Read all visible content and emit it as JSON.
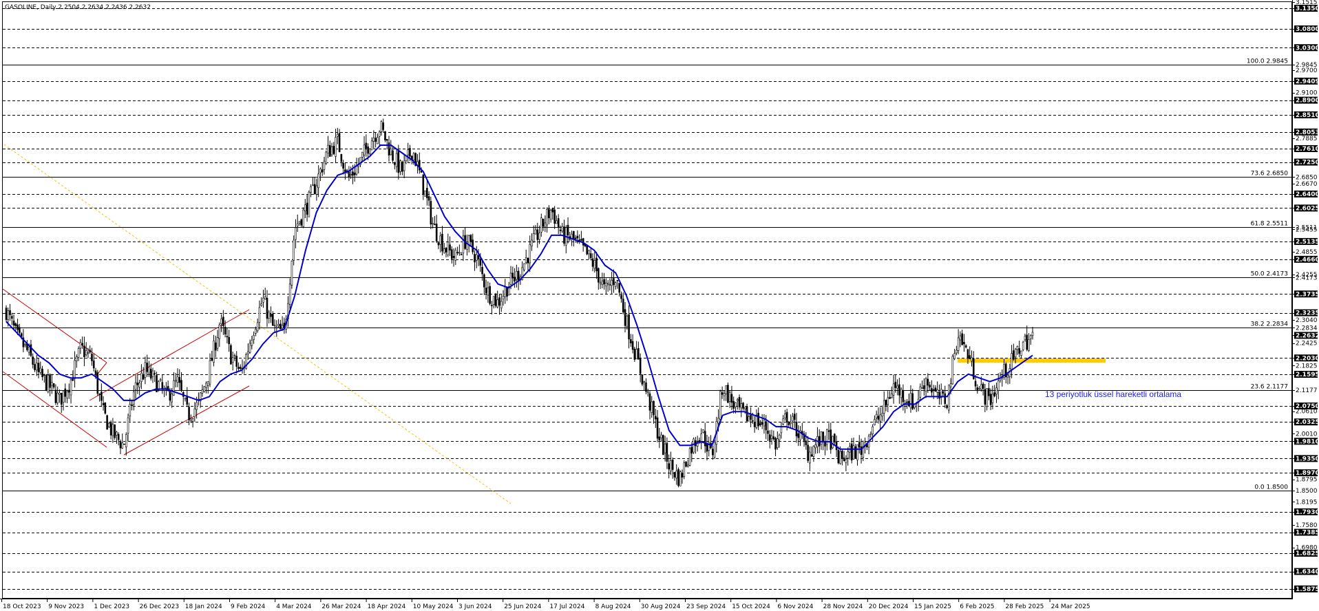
{
  "chart_data": {
    "type": "candlestick",
    "header": "GASOLINE, Daily  2.2504 2.2634 2.2436 2.2632",
    "ylim": [
      1.5635,
      3.1515
    ],
    "price_axis_ticks": [
      "3.1515",
      "3.1350",
      "3.0800",
      "3.0300",
      "2.9845",
      "2.9700",
      "2.9409",
      "2.9100",
      "2.8900",
      "2.8510",
      "2.8053",
      "2.7885",
      "2.7610",
      "2.7250",
      "2.6850",
      "2.6670",
      "2.6400",
      "2.6025",
      "2.5511",
      "2.5455",
      "2.5135",
      "2.4855",
      "2.4660",
      "2.4255",
      "2.4173",
      "2.3735",
      "2.3040",
      "2.2834",
      "2.2632",
      "2.2425",
      "2.2030",
      "2.1825",
      "2.1595",
      "2.1177",
      "2.0750",
      "2.0610",
      "2.0325",
      "2.0010",
      "1.9810",
      "1.9350",
      "1.8970",
      "1.8795",
      "1.8500",
      "1.8195",
      "1.7930",
      "1.7580",
      "1.7385",
      "1.6980",
      "1.6825",
      "1.6340",
      "1.5875"
    ],
    "highlighted_price_labels": [
      "3.1350",
      "3.0800",
      "3.0300",
      "2.9409",
      "2.8900",
      "2.8510",
      "2.8053",
      "2.7610",
      "2.7250",
      "2.6400",
      "2.6025",
      "2.5135",
      "2.4660",
      "2.3735",
      "2.3235",
      "2.2632",
      "2.2030",
      "2.1595",
      "2.0750",
      "2.0325",
      "1.9810",
      "1.9350",
      "1.8970",
      "1.7930",
      "1.7385",
      "1.6825",
      "1.6340",
      "1.5875"
    ],
    "date_labels": [
      "18 Oct 2023",
      "9 Nov 2023",
      "1 Dec 2023",
      "26 Dec 2023",
      "18 Jan 2024",
      "9 Feb 2024",
      "4 Mar 2024",
      "26 Mar 2024",
      "18 Apr 2024",
      "10 May 2024",
      "3 Jun 2024",
      "25 Jun 2024",
      "17 Jul 2024",
      "8 Aug 2024",
      "30 Aug 2024",
      "23 Sep 2024",
      "15 Oct 2024",
      "6 Nov 2024",
      "28 Nov 2024",
      "20 Dec 2024",
      "15 Jan 2025",
      "6 Feb 2025",
      "28 Feb 2025",
      "24 Mar 2025"
    ],
    "fibonacci_levels": [
      {
        "label": "100.0 2.9845",
        "price": 2.9845
      },
      {
        "label": "73.6 2.6850",
        "price": 2.685
      },
      {
        "label": "61.8 2.5511",
        "price": 2.5511
      },
      {
        "label": "50.0 2.4173",
        "price": 2.4173
      },
      {
        "label": "38.2 2.2834",
        "price": 2.2834
      },
      {
        "label": "23.6 2.1177",
        "price": 2.1177
      },
      {
        "label": "0.0 1.8500",
        "price": 1.85
      }
    ],
    "dashed_levels": [
      3.135,
      3.08,
      3.03,
      2.9409,
      2.89,
      2.851,
      2.8053,
      2.761,
      2.725,
      2.64,
      2.6025,
      2.5135,
      2.466,
      2.3735,
      2.3235,
      2.203,
      2.1595,
      2.075,
      2.0325,
      1.981,
      1.935,
      1.897,
      1.793,
      1.7385,
      1.6825,
      1.634,
      1.5875
    ],
    "price_path": [
      2.33,
      2.26,
      2.22,
      2.16,
      2.13,
      2.09,
      2.14,
      2.23,
      2.2,
      2.06,
      2.0,
      1.97,
      2.12,
      2.17,
      2.14,
      2.1,
      2.14,
      2.05,
      2.08,
      2.17,
      2.3,
      2.21,
      2.16,
      2.27,
      2.36,
      2.28,
      2.27,
      2.55,
      2.6,
      2.67,
      2.75,
      2.78,
      2.68,
      2.72,
      2.78,
      2.82,
      2.75,
      2.7,
      2.76,
      2.66,
      2.55,
      2.5,
      2.47,
      2.52,
      2.47,
      2.38,
      2.35,
      2.4,
      2.43,
      2.49,
      2.55,
      2.6,
      2.53,
      2.52,
      2.49,
      2.45,
      2.38,
      2.42,
      2.3,
      2.2,
      2.1,
      2.0,
      1.92,
      1.88,
      1.96,
      2.01,
      1.94,
      2.13,
      2.08,
      2.05,
      2.04,
      2.02,
      1.97,
      2.05,
      2.01,
      1.95,
      1.98,
      1.99,
      1.93,
      1.95,
      1.96,
      2.02,
      2.06,
      2.13,
      2.1,
      2.08,
      2.15,
      2.1,
      2.09,
      2.27,
      2.21,
      2.12,
      2.09,
      2.15,
      2.19,
      2.24,
      2.26
    ],
    "ema_label": "13 periyotluk üssel hareketli ortalama",
    "ema_path": [
      2.3,
      2.27,
      2.24,
      2.21,
      2.19,
      2.16,
      2.15,
      2.15,
      2.16,
      2.14,
      2.12,
      2.09,
      2.09,
      2.11,
      2.12,
      2.12,
      2.11,
      2.1,
      2.09,
      2.1,
      2.14,
      2.16,
      2.17,
      2.2,
      2.24,
      2.27,
      2.28,
      2.37,
      2.49,
      2.59,
      2.65,
      2.69,
      2.7,
      2.72,
      2.74,
      2.77,
      2.77,
      2.75,
      2.73,
      2.7,
      2.64,
      2.58,
      2.54,
      2.51,
      2.49,
      2.44,
      2.4,
      2.39,
      2.41,
      2.44,
      2.48,
      2.53,
      2.53,
      2.52,
      2.51,
      2.49,
      2.45,
      2.43,
      2.37,
      2.29,
      2.2,
      2.1,
      2.01,
      1.97,
      1.97,
      1.98,
      1.97,
      2.05,
      2.06,
      2.06,
      2.05,
      2.04,
      2.02,
      2.02,
      2.01,
      1.99,
      1.98,
      1.98,
      1.96,
      1.96,
      1.96,
      1.99,
      2.02,
      2.06,
      2.08,
      2.08,
      2.1,
      2.1,
      2.1,
      2.14,
      2.16,
      2.15,
      2.14,
      2.15,
      2.17,
      2.19,
      2.21
    ],
    "colors": {
      "ema": "#0000cc",
      "channel": "#cc0000",
      "trendline": "#f5c000",
      "resistance_zone": "#ffcc00",
      "grid": "#000000",
      "label_bg": "#000000",
      "label_text": "#ffffff"
    }
  }
}
